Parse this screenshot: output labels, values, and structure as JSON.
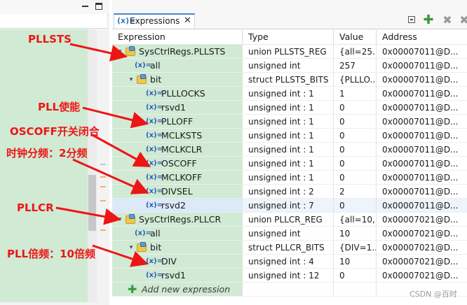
{
  "view": {
    "tab_label": "Expressions",
    "tab_icon": "(x)=",
    "close_glyph": "✕",
    "toolbar": [
      "collapse-all-icon",
      "add-expression-icon",
      "remove-expression-icon",
      "remove-all-icon"
    ]
  },
  "columns": [
    "Expression",
    "Type",
    "Value",
    "Address"
  ],
  "rows": [
    {
      "indent": 0,
      "twisty": "down",
      "icon": "struct",
      "expr": "SysCtrlRegs.PLLSTS",
      "type": "union PLLSTS_REG",
      "value": "{all=25...",
      "address": "0x00007011@D..."
    },
    {
      "indent": 1,
      "twisty": "none",
      "icon": "var",
      "expr": "all",
      "type": "unsigned int",
      "value": "257",
      "address": "0x00007011@D..."
    },
    {
      "indent": 1,
      "twisty": "down",
      "icon": "struct",
      "expr": "bit",
      "type": "struct PLLSTS_BITS",
      "value": "{PLLLO...",
      "address": "0x00007011@D..."
    },
    {
      "indent": 2,
      "twisty": "none",
      "icon": "var",
      "expr": "PLLLOCKS",
      "type": "unsigned int : 1",
      "value": "1",
      "address": "0x00007011@D..."
    },
    {
      "indent": 2,
      "twisty": "none",
      "icon": "var",
      "expr": "rsvd1",
      "type": "unsigned int : 1",
      "value": "0",
      "address": "0x00007011@D..."
    },
    {
      "indent": 2,
      "twisty": "none",
      "icon": "var",
      "expr": "PLLOFF",
      "type": "unsigned int : 1",
      "value": "0",
      "address": "0x00007011@D..."
    },
    {
      "indent": 2,
      "twisty": "none",
      "icon": "var",
      "expr": "MCLKSTS",
      "type": "unsigned int : 1",
      "value": "0",
      "address": "0x00007011@D..."
    },
    {
      "indent": 2,
      "twisty": "none",
      "icon": "var",
      "expr": "MCLKCLR",
      "type": "unsigned int : 1",
      "value": "0",
      "address": "0x00007011@D..."
    },
    {
      "indent": 2,
      "twisty": "none",
      "icon": "var",
      "expr": "OSCOFF",
      "type": "unsigned int : 1",
      "value": "0",
      "address": "0x00007011@D..."
    },
    {
      "indent": 2,
      "twisty": "none",
      "icon": "var",
      "expr": "MCLKOFF",
      "type": "unsigned int : 1",
      "value": "0",
      "address": "0x00007011@D..."
    },
    {
      "indent": 2,
      "twisty": "none",
      "icon": "var",
      "expr": "DIVSEL",
      "type": "unsigned int : 2",
      "value": "2",
      "address": "0x00007011@D..."
    },
    {
      "indent": 2,
      "twisty": "none",
      "icon": "var",
      "expr": "rsvd2",
      "type": "unsigned int : 7",
      "value": "0",
      "address": "0x00007011@D...",
      "selected": true
    },
    {
      "indent": 0,
      "twisty": "down",
      "icon": "struct",
      "expr": "SysCtrlRegs.PLLCR",
      "type": "union PLLCR_REG",
      "value": "{all=10,...",
      "address": "0x00007021@D..."
    },
    {
      "indent": 1,
      "twisty": "none",
      "icon": "var",
      "expr": "all",
      "type": "unsigned int",
      "value": "10",
      "address": "0x00007021@D..."
    },
    {
      "indent": 1,
      "twisty": "down",
      "icon": "struct",
      "expr": "bit",
      "type": "struct PLLCR_BITS",
      "value": "{DIV=1...",
      "address": "0x00007021@D..."
    },
    {
      "indent": 2,
      "twisty": "none",
      "icon": "var",
      "expr": "DIV",
      "type": "unsigned int : 4",
      "value": "10",
      "address": "0x00007021@D..."
    },
    {
      "indent": 2,
      "twisty": "none",
      "icon": "var",
      "expr": "rsvd1",
      "type": "unsigned int : 12",
      "value": "0",
      "address": "0x00007021@D..."
    }
  ],
  "add_new_expression": "Add new expression",
  "annotations": [
    {
      "text": "PLLSTS"
    },
    {
      "text": "PLL使能"
    },
    {
      "text": "OSCOFF开关闭合"
    },
    {
      "text": "时钟分频：2分频"
    },
    {
      "text": "PLLCR"
    },
    {
      "text": "PLL倍频：10倍频"
    }
  ],
  "watermark": "CSDN @百时",
  "colors": {
    "annotation": "#ee1515",
    "expression_bg": "#d0ead4",
    "selected_bg": "#dbe9f8"
  }
}
